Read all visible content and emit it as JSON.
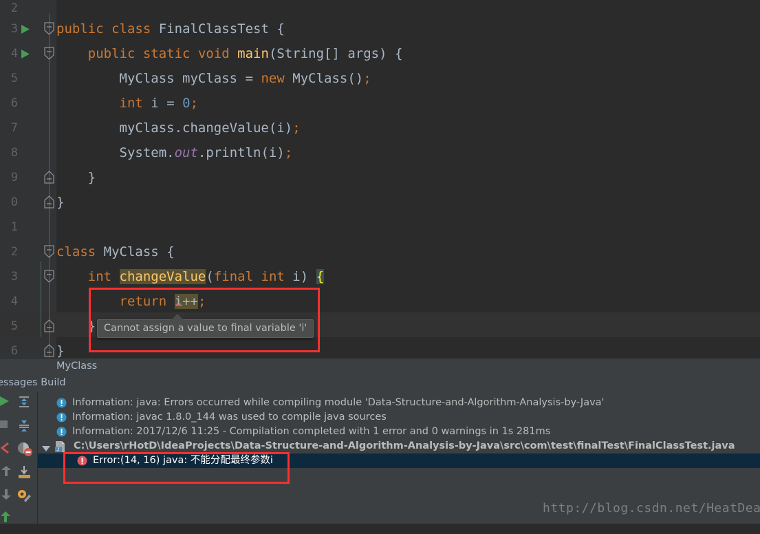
{
  "editor": {
    "line_numbers": [
      "2",
      "3",
      "4",
      "5",
      "6",
      "7",
      "8",
      "9",
      "0",
      "1",
      "2",
      "3",
      "4",
      "5",
      "6"
    ],
    "lines": [
      {
        "n": "2",
        "text": ""
      },
      {
        "n": "3",
        "text": "public class FinalClassTest {"
      },
      {
        "n": "4",
        "text": "    public static void main(String[] args) {"
      },
      {
        "n": "5",
        "text": "        MyClass myClass = new MyClass();"
      },
      {
        "n": "6",
        "text": "        int i = 0;"
      },
      {
        "n": "7",
        "text": "        myClass.changeValue(i);"
      },
      {
        "n": "8",
        "text": "        System.out.println(i);"
      },
      {
        "n": "9",
        "text": "    }"
      },
      {
        "n": "0",
        "text": "}"
      },
      {
        "n": "1",
        "text": ""
      },
      {
        "n": "2",
        "text": "class MyClass {"
      },
      {
        "n": "3",
        "text": "    int changeValue(final int i) {"
      },
      {
        "n": "4",
        "text": "        return i++;"
      },
      {
        "n": "5",
        "text": "    }"
      },
      {
        "n": "6",
        "text": "}"
      }
    ],
    "tokens": {
      "kw_public": "public",
      "kw_class": "class",
      "kw_static": "static",
      "kw_void": "void",
      "kw_new": "new",
      "kw_int": "int",
      "kw_final": "final",
      "kw_return": "return",
      "type_finalclasstest": "FinalClassTest",
      "type_myclass": "MyClass",
      "type_string": "String",
      "method_main": "main",
      "method_changevalue": "changeValue",
      "method_println": "println",
      "var_myclass": "myClass",
      "var_args": "args",
      "var_i": "i",
      "literal_zero": "0",
      "field_out": "out",
      "class_system": "System",
      "open_brace": "{",
      "close_brace": "}"
    },
    "colors": {
      "background": "#2b2b2b",
      "gutter": "#313335",
      "keyword": "#cc7832",
      "identifier": "#a9b7c6",
      "number": "#6897bb",
      "method": "#ffc66d",
      "static_field": "#9876aa",
      "line_number": "#606366",
      "caret_line": "#323232",
      "identifier_highlight_bg": "#5a5332",
      "brace_highlight_bg": "#3b514d",
      "brace_highlight_fg": "#ffef28"
    },
    "run_markers": [
      "run-line-3",
      "run-line-4"
    ]
  },
  "tooltip": {
    "message": "Cannot assign a value to final variable 'i'"
  },
  "breadcrumb": {
    "label": "MyClass"
  },
  "toolwindow": {
    "tab_label": "essages Build"
  },
  "left_toolbar": {
    "icons": [
      "run-icon",
      "expand-all-icon",
      "stop-icon",
      "collapse-all-icon",
      "previous-occurrence-icon",
      "hide-warnings-icon",
      "next-occurrence-icon",
      "export-to-file-icon",
      "up-arrow-icon",
      "settings-icon"
    ]
  },
  "messages": {
    "rows": [
      {
        "kind": "information",
        "icon": "information-icon",
        "text": "Information: java: Errors occurred while compiling module 'Data-Structure-and-Algorithm-Analysis-by-Java'"
      },
      {
        "kind": "information",
        "icon": "information-icon",
        "text": "Information: javac 1.8.0_144 was used to compile java sources"
      },
      {
        "kind": "information",
        "icon": "information-icon",
        "text": "Information: 2017/12/6 11:25 - Compilation completed with 1 error and 0 warnings in 1s 281ms"
      },
      {
        "kind": "file",
        "icon": "java-file-icon",
        "twisty": "triangle-down-icon",
        "text": "C:\\Users\\rHotD\\IdeaProjects\\Data-Structure-and-Algorithm-Analysis-by-Java\\src\\com\\test\\finalTest\\FinalClassTest.java"
      },
      {
        "kind": "error",
        "icon": "error-icon",
        "selected": true,
        "text": "Error:(14, 16)  java: 不能分配最终参数i"
      }
    ]
  },
  "annotations": {
    "highlight_color": "#ff2f2f",
    "boxes": [
      "code-error-box",
      "build-error-box"
    ]
  },
  "watermark": {
    "text": "http://blog.csdn.net/HeatDeath"
  }
}
